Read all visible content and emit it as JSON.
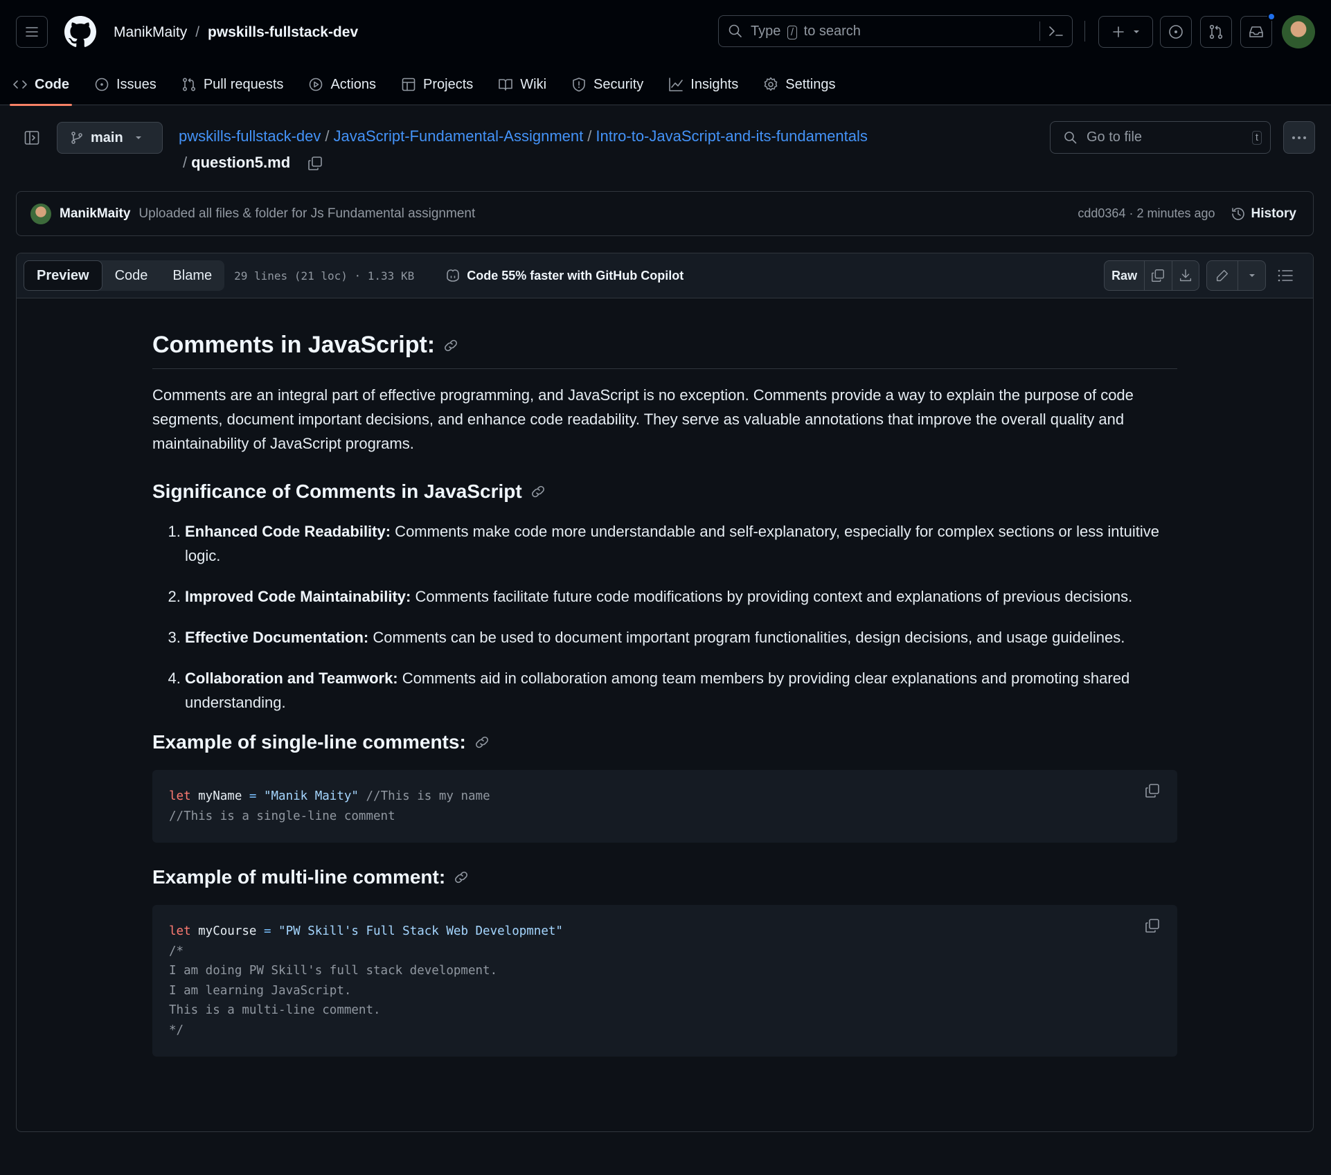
{
  "header": {
    "owner": "ManikMaity",
    "separator": "/",
    "repo": "pwskills-fullstack-dev",
    "search_prefix": "Type",
    "search_key": "/",
    "search_suffix": "to search"
  },
  "tabs": [
    {
      "label": "Code",
      "icon": "code-icon"
    },
    {
      "label": "Issues",
      "icon": "issue-icon"
    },
    {
      "label": "Pull requests",
      "icon": "pull-request-icon"
    },
    {
      "label": "Actions",
      "icon": "play-icon"
    },
    {
      "label": "Projects",
      "icon": "table-icon"
    },
    {
      "label": "Wiki",
      "icon": "book-icon"
    },
    {
      "label": "Security",
      "icon": "shield-icon"
    },
    {
      "label": "Insights",
      "icon": "graph-icon"
    },
    {
      "label": "Settings",
      "icon": "gear-icon"
    }
  ],
  "branch": "main",
  "breadcrumb": {
    "parts": [
      "pwskills-fullstack-dev",
      "JavaScript-Fundamental-Assignment",
      "Intro-to-JavaScript-and-its-fundamentals"
    ],
    "file": "question5.md"
  },
  "gofile": {
    "placeholder": "Go to file",
    "key": "t"
  },
  "commit": {
    "author": "ManikMaity",
    "message": "Uploaded all files & folder for Js Fundamental assignment",
    "meta": "cdd0364 · 2 minutes ago",
    "history": "History"
  },
  "filehead": {
    "preview": "Preview",
    "code": "Code",
    "blame": "Blame",
    "lines": "29 lines (21 loc) · 1.33 KB",
    "copilot": "Code 55% faster with GitHub Copilot",
    "raw": "Raw"
  },
  "doc": {
    "h1": "Comments in JavaScript:",
    "intro": "Comments are an integral part of effective programming, and JavaScript is no exception. Comments provide a way to explain the purpose of code segments, document important decisions, and enhance code readability. They serve as valuable annotations that improve the overall quality and maintainability of JavaScript programs.",
    "h2_significance": "Significance of Comments in JavaScript",
    "list": [
      {
        "term": "Enhanced Code Readability:",
        "text": " Comments make code more understandable and self-explanatory, especially for complex sections or less intuitive logic."
      },
      {
        "term": "Improved Code Maintainability:",
        "text": " Comments facilitate future code modifications by providing context and explanations of previous decisions."
      },
      {
        "term": "Effective Documentation:",
        "text": " Comments can be used to document important program functionalities, design decisions, and usage guidelines."
      },
      {
        "term": "Collaboration and Teamwork:",
        "text": " Comments aid in collaboration among team members by providing clear explanations and promoting shared understanding."
      }
    ],
    "h2_single": "Example of single-line comments:",
    "code1": {
      "kw": "let",
      "name": " myName ",
      "op": "=",
      "str": " \"Manik Maity\"",
      "trail": " //This is my name",
      "line2": "//This is a single-line comment"
    },
    "h2_multi": "Example of multi-line comment:",
    "code2": {
      "kw": "let",
      "name": " myCourse ",
      "op": "=",
      "str": " \"PW Skill's Full Stack Web Developmnet\"",
      "open": "/*",
      "l1": "I am doing PW Skill's full stack development.",
      "l2": "I am learning JavaScript.",
      "l3": "This is a multi-line comment.",
      "close": "*/"
    }
  },
  "colors": {
    "accent": "#4493f8",
    "tab_underline": "#f78166",
    "notification_dot": "#1f6feb"
  }
}
